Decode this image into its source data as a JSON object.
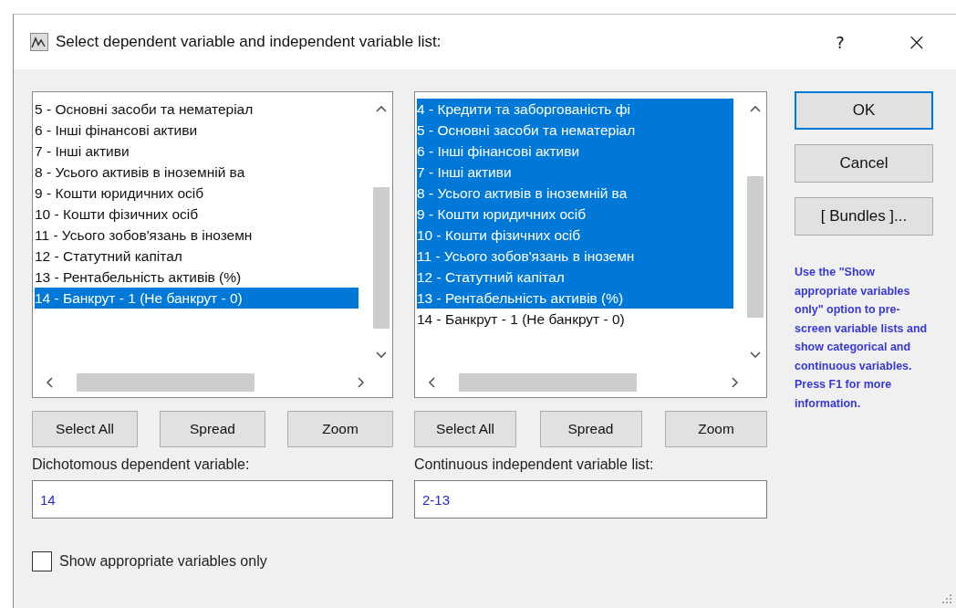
{
  "window": {
    "title": "Select dependent variable and independent variable list:",
    "help": "?",
    "close": "×"
  },
  "left_panel": {
    "items": [
      {
        "label": "5 - Основні засоби та нематеріал",
        "selected": false
      },
      {
        "label": "6 - Інші фінансові активи",
        "selected": false
      },
      {
        "label": "7 - Інші активи",
        "selected": false
      },
      {
        "label": "8 - Усього активів в іноземній ва",
        "selected": false
      },
      {
        "label": "9 - Кошти юридичних осіб",
        "selected": false
      },
      {
        "label": "10 - Кошти фізичних осіб",
        "selected": false
      },
      {
        "label": "11 - Усього зобов'язань в іноземн",
        "selected": false
      },
      {
        "label": "12 - Статутний капітал",
        "selected": false
      },
      {
        "label": "13 - Рентабельність активів (%)",
        "selected": false
      },
      {
        "label": "14 - Банкрут - 1 (Не банкрут - 0)",
        "selected": true
      }
    ],
    "buttons": [
      "Select All",
      "Spread",
      "Zoom"
    ],
    "field_label": "Dichotomous dependent variable:",
    "field_value": "14"
  },
  "right_panel": {
    "items": [
      {
        "label": "4 - Кредити та заборгованість фі",
        "selected": true
      },
      {
        "label": "5 - Основні засоби та нематеріал",
        "selected": true
      },
      {
        "label": "6 - Інші фінансові активи",
        "selected": true
      },
      {
        "label": "7 - Інші активи",
        "selected": true
      },
      {
        "label": "8 - Усього активів в іноземній ва",
        "selected": true
      },
      {
        "label": "9 - Кошти юридичних осіб",
        "selected": true
      },
      {
        "label": "10 - Кошти фізичних осіб",
        "selected": true
      },
      {
        "label": "11 - Усього зобов'язань в іноземн",
        "selected": true
      },
      {
        "label": "12 - Статутний капітал",
        "selected": true
      },
      {
        "label": "13 - Рентабельність активів (%)",
        "selected": true
      },
      {
        "label": "14 - Банкрут - 1 (Не банкрут - 0)",
        "selected": false
      }
    ],
    "buttons": [
      "Select All",
      "Spread",
      "Zoom"
    ],
    "field_label": "Continuous independent variable list:",
    "field_value": "2-13"
  },
  "side_buttons": [
    {
      "label": "OK",
      "default": true
    },
    {
      "label": "Cancel",
      "default": false
    },
    {
      "label": "[ Bundles ]...",
      "default": false
    }
  ],
  "help_text": "Use the \"Show appropriate variables only\" option to pre-screen variable lists and show categorical and continuous variables. Press F1 for more information.",
  "checkbox": {
    "label": "Show appropriate variables only",
    "checked": false
  }
}
